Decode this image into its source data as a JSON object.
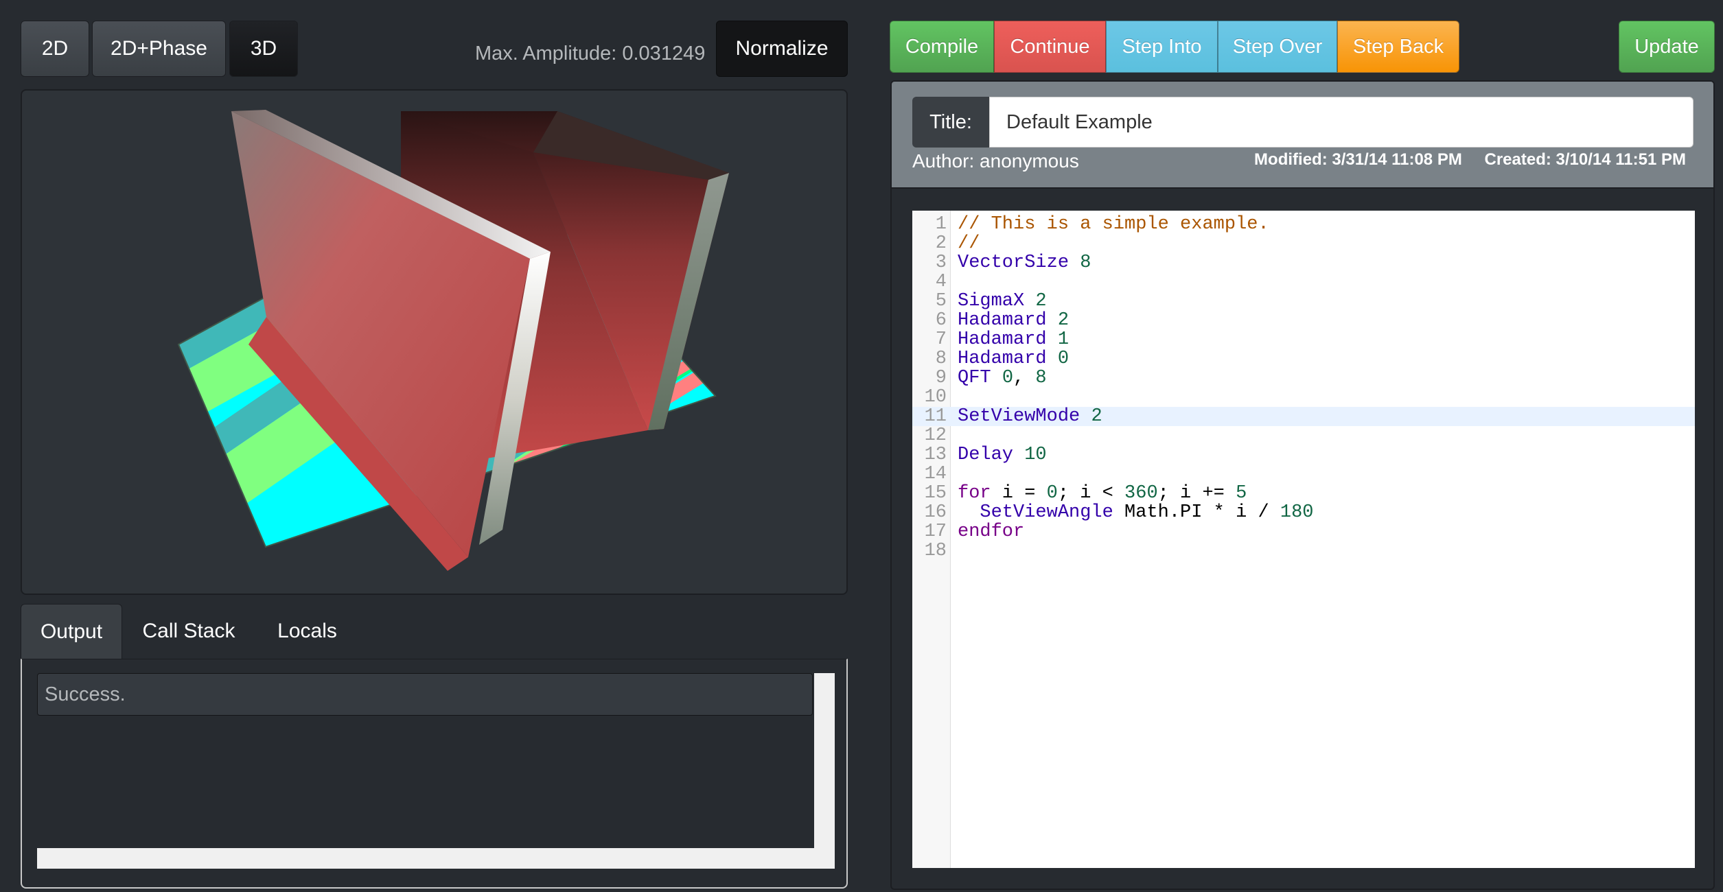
{
  "view_modes": [
    {
      "label": "2D",
      "active": false
    },
    {
      "label": "2D+Phase",
      "active": false
    },
    {
      "label": "3D",
      "active": true
    }
  ],
  "max_amplitude": "Max. Amplitude: 0.031249",
  "normalize_label": "Normalize",
  "debug_buttons": {
    "compile": "Compile",
    "continue": "Continue",
    "step_into": "Step Into",
    "step_over": "Step Over",
    "step_back": "Step Back",
    "update": "Update"
  },
  "colors": {
    "compile": "#5cb85c",
    "continue": "#d9534f",
    "step": "#5bc0de",
    "step_back": "#f89406",
    "plane_cyan": "#00ffff",
    "plane_green": "#80ff80",
    "plane_red": "#ff8080",
    "wall_red": "#c04040"
  },
  "info": {
    "title_label": "Title:",
    "title_value": "Default Example",
    "author": "Author: anonymous",
    "modified": "Modified: 3/31/14 11:08 PM",
    "created": "Created: 3/10/14 11:51 PM"
  },
  "tabs": [
    {
      "label": "Output",
      "active": true
    },
    {
      "label": "Call Stack",
      "active": false
    },
    {
      "label": "Locals",
      "active": false
    }
  ],
  "output_text": "Success.",
  "code": {
    "active_line": 11,
    "lines": [
      [
        [
          "comment",
          "// This is a simple example."
        ]
      ],
      [
        [
          "comment",
          "//"
        ]
      ],
      [
        [
          "cmd",
          "VectorSize"
        ],
        [
          "plain",
          " "
        ],
        [
          "num",
          "8"
        ]
      ],
      [],
      [
        [
          "cmd",
          "SigmaX"
        ],
        [
          "plain",
          " "
        ],
        [
          "num",
          "2"
        ]
      ],
      [
        [
          "cmd",
          "Hadamard"
        ],
        [
          "plain",
          " "
        ],
        [
          "num",
          "2"
        ]
      ],
      [
        [
          "cmd",
          "Hadamard"
        ],
        [
          "plain",
          " "
        ],
        [
          "num",
          "1"
        ]
      ],
      [
        [
          "cmd",
          "Hadamard"
        ],
        [
          "plain",
          " "
        ],
        [
          "num",
          "0"
        ]
      ],
      [
        [
          "cmd",
          "QFT"
        ],
        [
          "plain",
          " "
        ],
        [
          "num",
          "0"
        ],
        [
          "plain",
          ", "
        ],
        [
          "num",
          "8"
        ]
      ],
      [],
      [
        [
          "cmd",
          "SetViewMode"
        ],
        [
          "plain",
          " "
        ],
        [
          "num",
          "2"
        ]
      ],
      [],
      [
        [
          "cmd",
          "Delay"
        ],
        [
          "plain",
          " "
        ],
        [
          "num",
          "10"
        ]
      ],
      [],
      [
        [
          "kw",
          "for"
        ],
        [
          "plain",
          " i = "
        ],
        [
          "num",
          "0"
        ],
        [
          "plain",
          "; i < "
        ],
        [
          "num",
          "360"
        ],
        [
          "plain",
          "; i += "
        ],
        [
          "num",
          "5"
        ]
      ],
      [
        [
          "plain",
          "  "
        ],
        [
          "cmd",
          "SetViewAngle"
        ],
        [
          "plain",
          " Math.PI * i / "
        ],
        [
          "num",
          "180"
        ]
      ],
      [
        [
          "kw",
          "endfor"
        ]
      ],
      []
    ]
  }
}
